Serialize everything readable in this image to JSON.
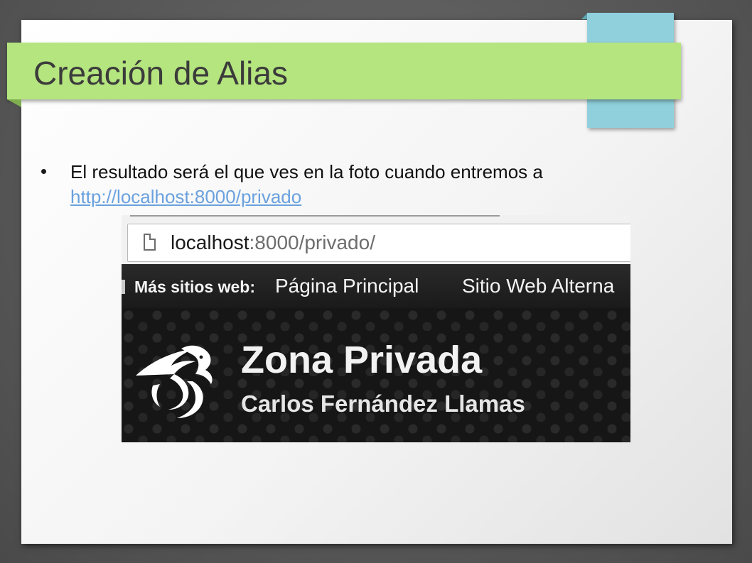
{
  "slide": {
    "title": "Creación de Alias",
    "bullet_text": "El resultado será el que ves en la foto cuando entremos a",
    "bullet_link": "http://localhost:8000/privado"
  },
  "screenshot": {
    "address_bar": {
      "host": "localhost",
      "path": ":8000/privado/"
    },
    "nav": {
      "lead": "Más sitios web:",
      "links": [
        "Página Principal",
        "Sitio Web Alterna"
      ]
    },
    "hero": {
      "title": "Zona Privada",
      "subtitle": "Carlos Fernández Llamas"
    }
  },
  "colors": {
    "title_band": "#b5e57f",
    "accent_tab": "#8fd0dc",
    "link": "#6aa1de"
  },
  "icons": {
    "page": "page-icon",
    "logo": "dragon-logo-icon"
  }
}
